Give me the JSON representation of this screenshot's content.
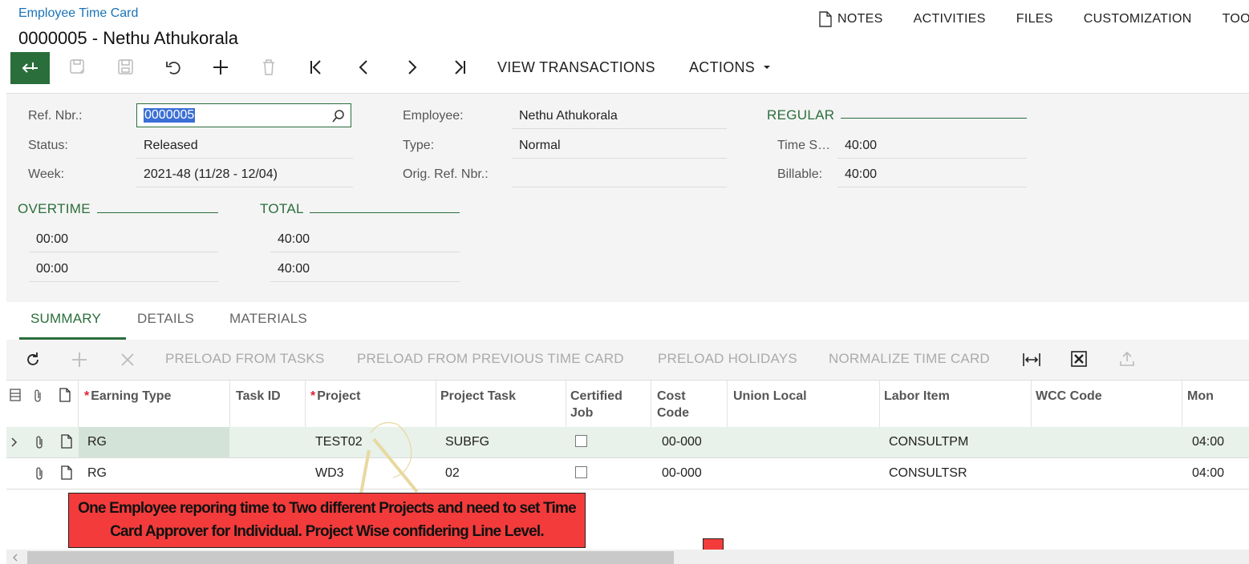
{
  "header": {
    "breadcrumb": "Employee Time Card",
    "title": "0000005 - Nethu Athukorala",
    "links": [
      "NOTES",
      "ACTIVITIES",
      "FILES",
      "CUSTOMIZATION",
      "TOOI"
    ]
  },
  "toolbar": {
    "view_transactions": "VIEW TRANSACTIONS",
    "actions": "ACTIONS"
  },
  "form": {
    "ref_label": "Ref. Nbr.:",
    "ref_value": "0000005",
    "status_label": "Status:",
    "status_value": "Released",
    "week_label": "Week:",
    "week_value": "2021-48 (11/28 - 12/04)",
    "employee_label": "Employee:",
    "employee_value": "Nethu Athukorala",
    "type_label": "Type:",
    "type_value": "Normal",
    "orig_label": "Orig. Ref. Nbr.:",
    "orig_value": "",
    "regular_title": "REGULAR",
    "time_spent_label": "Time S…",
    "time_spent_value": "40:00",
    "billable_label": "Billable:",
    "billable_value": "40:00",
    "overtime_title": "OVERTIME",
    "overtime_values": [
      "00:00",
      "00:00"
    ],
    "total_title": "TOTAL",
    "total_values": [
      "40:00",
      "40:00"
    ]
  },
  "tabs": [
    "SUMMARY",
    "DETAILS",
    "MATERIALS"
  ],
  "grid_toolbar": [
    "PRELOAD FROM TASKS",
    "PRELOAD FROM PREVIOUS TIME CARD",
    "PRELOAD HOLIDAYS",
    "NORMALIZE TIME CARD"
  ],
  "grid": {
    "columns": {
      "earning_type": "Earning Type",
      "task_id": "Task ID",
      "project": "Project",
      "project_task": "Project Task",
      "certified_job_1": "Certified",
      "certified_job_2": "Job",
      "cost_code_1": "Cost",
      "cost_code_2": "Code",
      "union_local": "Union Local",
      "labor_item": "Labor Item",
      "wcc_code": "WCC Code",
      "mon": "Mon"
    },
    "rows": [
      {
        "earning_type": "RG",
        "task_id": "",
        "project": "TEST02",
        "project_task": "SUBFG",
        "certified": false,
        "cost_code": "00-000",
        "union_local": "",
        "labor_item": "CONSULTPM",
        "wcc_code": "",
        "mon": "04:00"
      },
      {
        "earning_type": "RG",
        "task_id": "",
        "project": "WD3",
        "project_task": "02",
        "certified": false,
        "cost_code": "00-000",
        "union_local": "",
        "labor_item": "CONSULTSR",
        "wcc_code": "",
        "mon": "04:00"
      }
    ]
  },
  "annotation": {
    "line1": "One Employee reporing time to Two different Projects and need to set Time",
    "line2": "Card Approver for Individual. Project Wise confidering Line Level."
  },
  "colors": {
    "accent": "#2a6e3b",
    "link": "#1a73b8",
    "annotation_red": "#f33b3b",
    "selection": "#3b6fd4"
  }
}
